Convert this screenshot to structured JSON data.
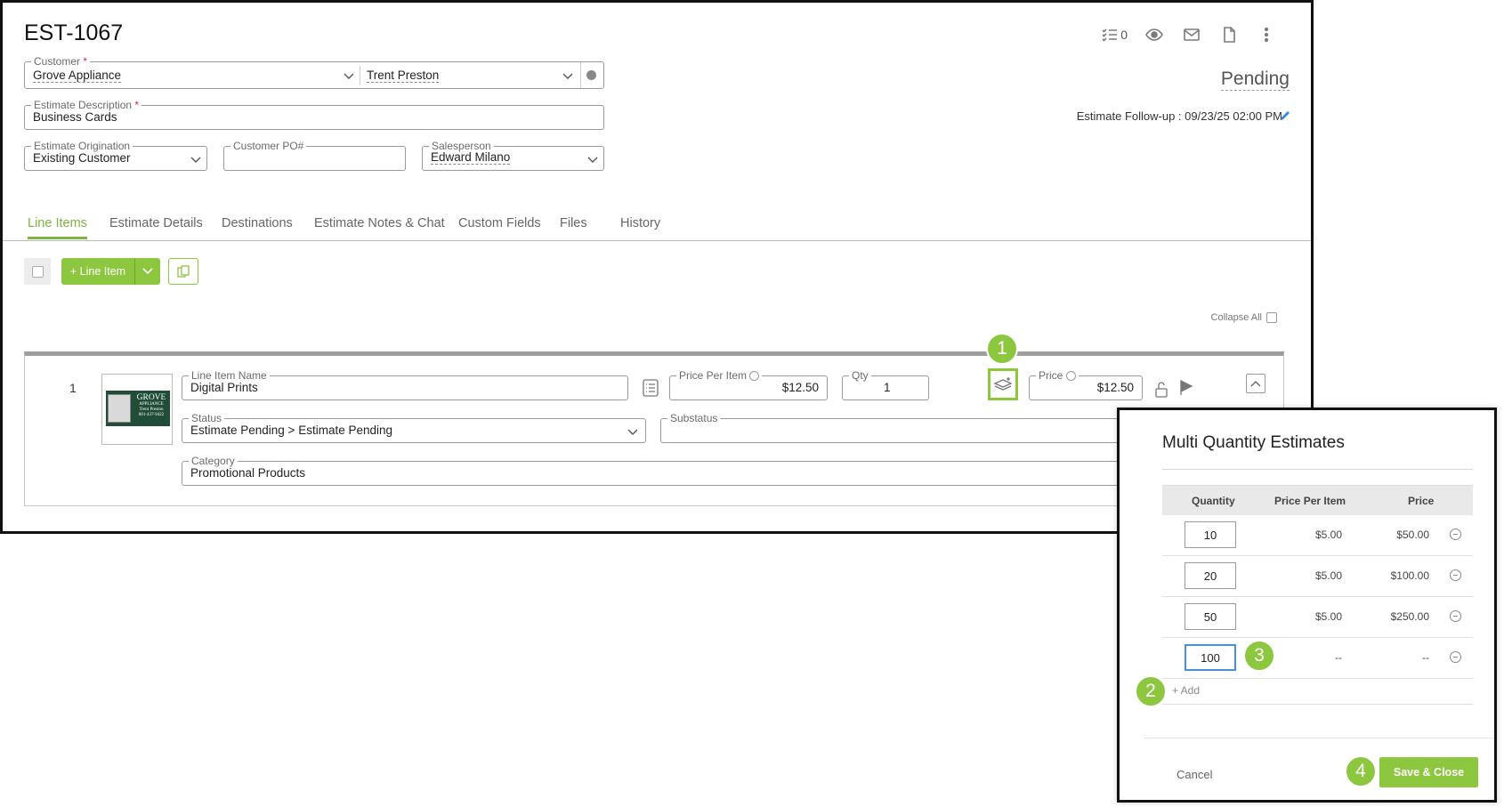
{
  "estimate": {
    "number": "EST-1067",
    "status": "Pending",
    "followup": "Estimate Follow-up : 09/23/25 02:00 PM"
  },
  "header_icons": {
    "checklist_count": "0"
  },
  "form": {
    "customer_label": "Customer",
    "customer_value": "Grove Appliance",
    "contact_value": "Trent Preston",
    "description_label": "Estimate Description",
    "description_value": "Business Cards",
    "origination_label": "Estimate Origination",
    "origination_value": "Existing Customer",
    "po_label": "Customer PO#",
    "po_value": "",
    "salesperson_label": "Salesperson",
    "salesperson_value": "Edward Milano",
    "required_mark": "*"
  },
  "tabs": [
    {
      "label": "Line Items",
      "active": true
    },
    {
      "label": "Estimate Details"
    },
    {
      "label": "Destinations"
    },
    {
      "label": "Estimate Notes & Chat"
    },
    {
      "label": "Custom Fields"
    },
    {
      "label": "Files"
    },
    {
      "label": "History"
    }
  ],
  "toolbar": {
    "add_line_label": "+ Line Item",
    "collapse_all": "Collapse All"
  },
  "line_item": {
    "number": "1",
    "thumbnail_brand": "GROVE",
    "thumbnail_sub": "APPLIANCE",
    "thumbnail_contact": "Trent Preston",
    "thumbnail_phone": "801-437-9422",
    "name_label": "Line Item Name",
    "name_value": "Digital Prints",
    "ppi_label": "Price Per Item",
    "ppi_value": "$12.50",
    "qty_label": "Qty",
    "qty_value": "1",
    "price_label": "Price",
    "price_value": "$12.50",
    "status_label": "Status",
    "status_value": "Estimate Pending > Estimate Pending",
    "substatus_label": "Substatus",
    "substatus_value": "",
    "category_label": "Category",
    "category_value": "Promotional Products"
  },
  "callouts": [
    "1",
    "2",
    "3",
    "4"
  ],
  "modal": {
    "title": "Multi Quantity Estimates",
    "col_qty": "Quantity",
    "col_ppi": "Price Per Item",
    "col_price": "Price",
    "rows": [
      {
        "qty": "10",
        "ppi": "$5.00",
        "price": "$50.00"
      },
      {
        "qty": "20",
        "ppi": "$5.00",
        "price": "$100.00"
      },
      {
        "qty": "50",
        "ppi": "$5.00",
        "price": "$250.00"
      },
      {
        "qty": "100",
        "ppi": "--",
        "price": "--"
      }
    ],
    "add_label": "+ Add",
    "cancel_label": "Cancel",
    "save_label": "Save & Close"
  },
  "colors": {
    "accent": "#8dc63f",
    "focus": "#4a90d9"
  }
}
